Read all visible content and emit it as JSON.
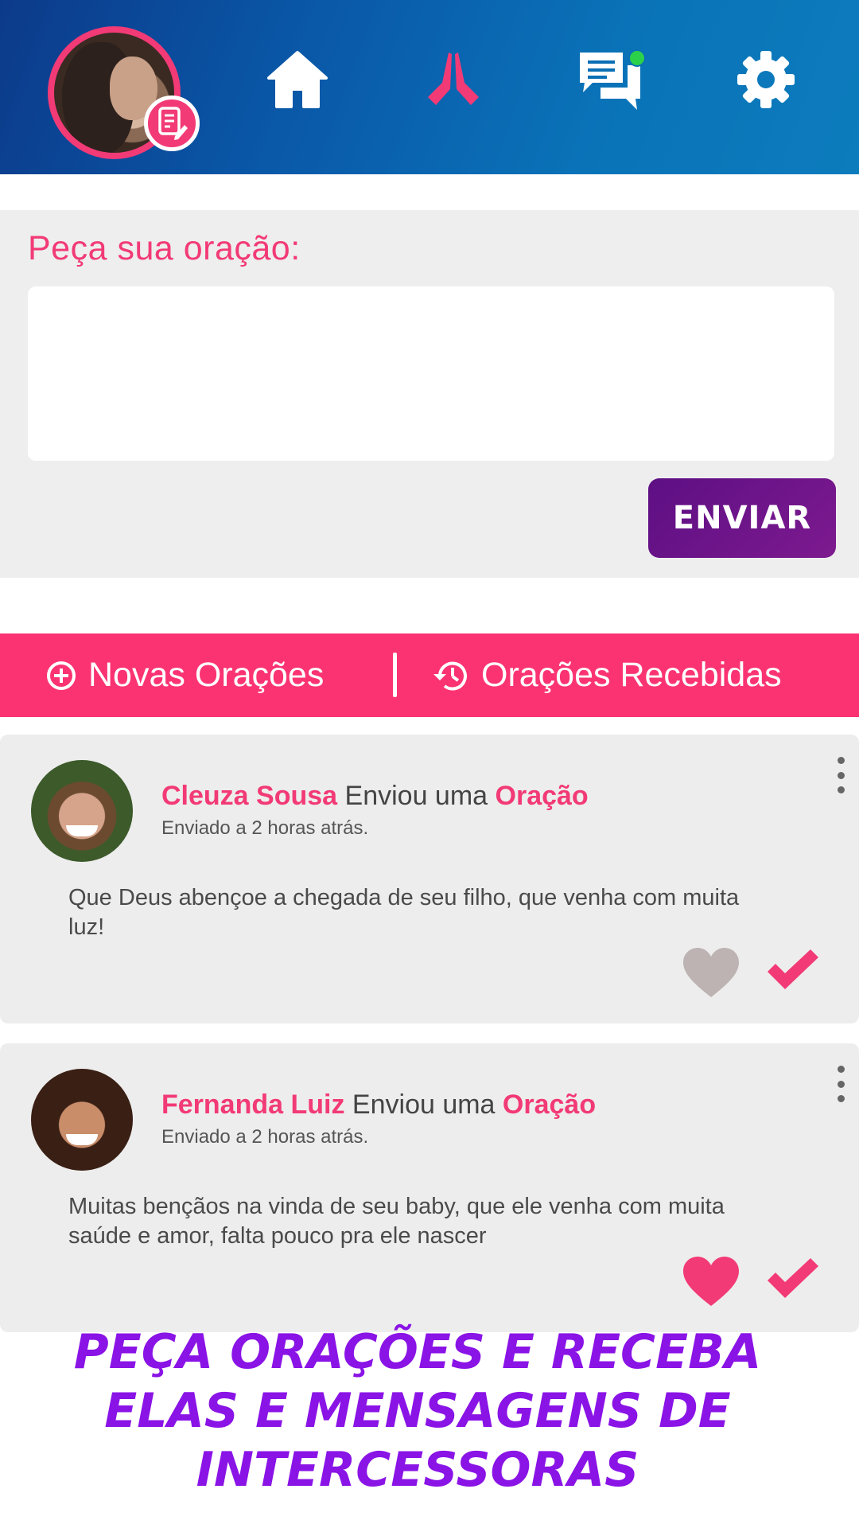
{
  "header": {
    "online_indicator_color": "#2bd14b",
    "nav": [
      {
        "name": "home",
        "icon": "home-icon"
      },
      {
        "name": "prayers",
        "icon": "praying-hands-icon",
        "active": true
      },
      {
        "name": "messages",
        "icon": "chat-bubbles-icon"
      },
      {
        "name": "settings",
        "icon": "gear-icon"
      }
    ]
  },
  "request": {
    "title": "Peça sua oração:",
    "input_value": "",
    "send_label": "ENVIAR"
  },
  "tabs": {
    "new_label": "Novas Orações",
    "received_label": "Orações Recebidas"
  },
  "cards": [
    {
      "name": "Cleuza Sousa",
      "action": "Enviou uma",
      "kind": "Oração",
      "time": "Enviado a 2 horas atrás.",
      "text": "Que Deus abençoe a chegada de seu filho, que venha com muita luz!",
      "liked": false
    },
    {
      "name": "Fernanda Luiz",
      "action": "Enviou uma",
      "kind": "Oração",
      "time": "Enviado a 2 horas atrás.",
      "text": "Muitas bençãos na vinda de seu baby, que ele venha com muita saúde e amor, falta pouco pra ele nascer",
      "liked": true
    }
  ],
  "promo": {
    "line1": "PEÇA ORAÇÕES E RECEBA",
    "line2": "ELAS E MENSAGENS DE",
    "line3": "INTERCESSORAS"
  },
  "colors": {
    "accent_pink": "#f23a76",
    "tab_bar": "#fb3372",
    "send_button": "#6a1287",
    "promo_text": "#8a13e6",
    "like_inactive": "#bdb3b3"
  }
}
